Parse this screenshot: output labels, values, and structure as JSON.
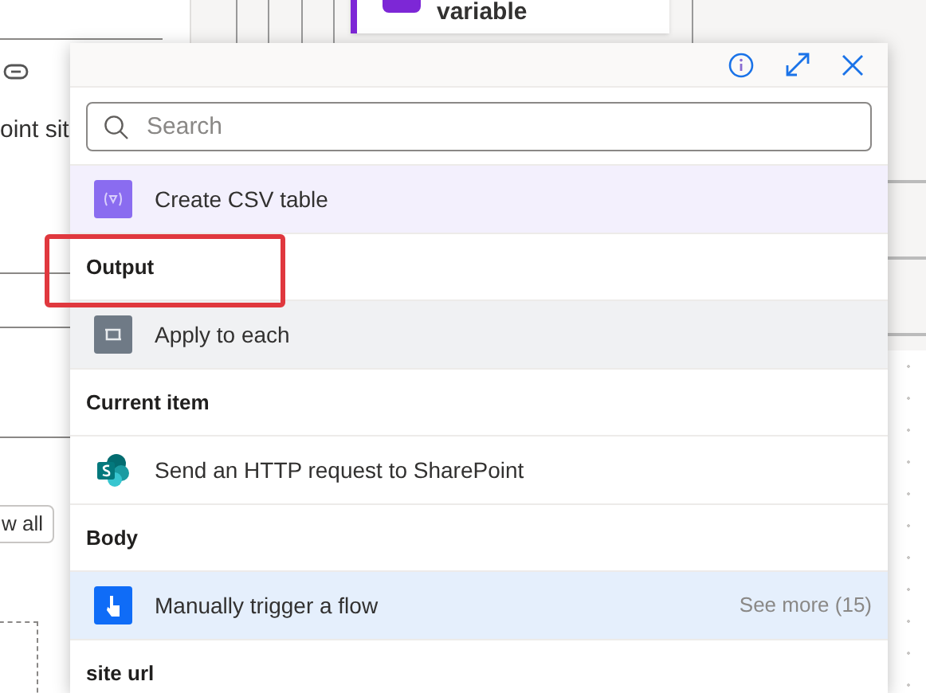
{
  "left_panel": {
    "field_text": "oint sit",
    "button_label": "w all"
  },
  "canvas_node": {
    "title": "variable"
  },
  "popup": {
    "search": {
      "placeholder": "Search"
    },
    "items": [
      {
        "kind": "action",
        "title": "Create CSV table"
      },
      {
        "kind": "output",
        "title": "Output",
        "annotated": true
      },
      {
        "kind": "action",
        "title": "Apply to each"
      },
      {
        "kind": "output",
        "title": "Current item",
        "annotated": false
      },
      {
        "kind": "action",
        "title": "Send an HTTP request to SharePoint"
      },
      {
        "kind": "output",
        "title": "Body",
        "annotated": false
      },
      {
        "kind": "action",
        "title": "Manually trigger a flow",
        "more": "See more (15)"
      },
      {
        "kind": "output",
        "title": "site url",
        "annotated": false
      }
    ]
  }
}
